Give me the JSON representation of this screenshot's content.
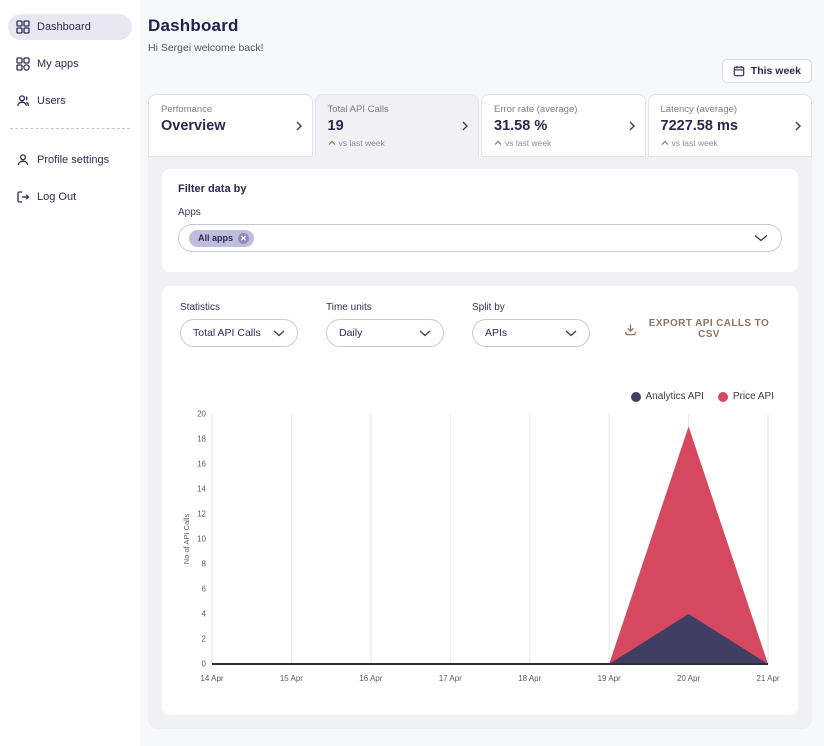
{
  "sidebar": {
    "items": [
      {
        "label": "Dashboard"
      },
      {
        "label": "My apps"
      },
      {
        "label": "Users"
      }
    ],
    "footer_items": [
      {
        "label": "Profile settings"
      },
      {
        "label": "Log Out"
      }
    ]
  },
  "header": {
    "title": "Dashboard",
    "subtitle": "Hi Sergei welcome back!",
    "period_button": "This week"
  },
  "stat_cards": [
    {
      "label": "Perfomance",
      "value": "Overview",
      "sub": ""
    },
    {
      "label": "Total API Calls",
      "value": "19",
      "sub": "vs last week"
    },
    {
      "label": "Error rate (average)",
      "value": "31.58 %",
      "sub": "vs last week"
    },
    {
      "label": "Latency (average)",
      "value": "7227.58 ms",
      "sub": "vs last week"
    }
  ],
  "filter": {
    "title": "Filter data by",
    "label": "Apps",
    "chip": "All apps"
  },
  "controls": {
    "statistics_label": "Statistics",
    "statistics_value": "Total API Calls",
    "time_units_label": "Time units",
    "time_units_value": "Daily",
    "split_by_label": "Split by",
    "split_by_value": "APIs",
    "export_label": "EXPORT API CALLS TO CSV"
  },
  "icons": {
    "chip_remove": "✕"
  },
  "colors": {
    "analytics": "#413e63",
    "price": "#d6485f",
    "export": "#8d7364",
    "active_tab_bg": "#f1f1f4"
  },
  "chart_data": {
    "type": "area",
    "stacked": true,
    "x": [
      "14 Apr",
      "15 Apr",
      "16 Apr",
      "17 Apr",
      "18 Apr",
      "19 Apr",
      "20 Apr",
      "21 Apr"
    ],
    "series": [
      {
        "name": "Analytics API",
        "color": "#413e63",
        "values": [
          0,
          0,
          0,
          0,
          0,
          0,
          4,
          0
        ]
      },
      {
        "name": "Price API",
        "color": "#d6485f",
        "values": [
          0,
          0,
          0,
          0,
          0,
          0,
          15,
          0
        ]
      }
    ],
    "title": "",
    "xlabel": "",
    "ylabel": "No of API Calls",
    "ylim": [
      0,
      20
    ],
    "ytick_step": 2,
    "grid": "vertical",
    "legend_position": "top-right"
  }
}
